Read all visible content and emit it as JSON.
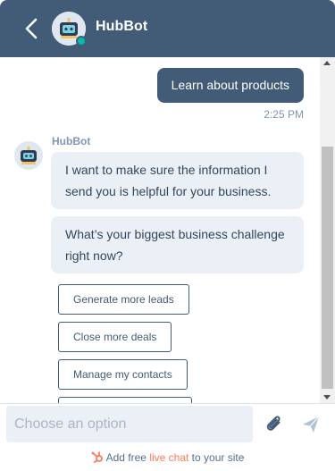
{
  "header": {
    "title": "HubBot"
  },
  "thread": {
    "user_message": "Learn about products",
    "timestamp": "2:25 PM",
    "sender_name": "HubBot",
    "bot_messages": [
      "I want to make sure the information I send you is helpful for your business.",
      "What’s your biggest business challenge right now?"
    ],
    "options": [
      "Generate more leads",
      "Close more deals",
      "Manage my contacts",
      ""
    ]
  },
  "composer": {
    "placeholder": "Choose an option"
  },
  "branding": {
    "prefix": "Add free ",
    "link": "live chat",
    "suffix": " to your site"
  },
  "colors": {
    "header": "#425b76",
    "bubble_bot": "#eaf0f6",
    "accent": "#ff7a59",
    "online": "#00bda5"
  },
  "icons": [
    "back-arrow-icon",
    "bot-avatar-icon",
    "paperclip-icon",
    "send-icon",
    "hubspot-sprocket-icon"
  ]
}
